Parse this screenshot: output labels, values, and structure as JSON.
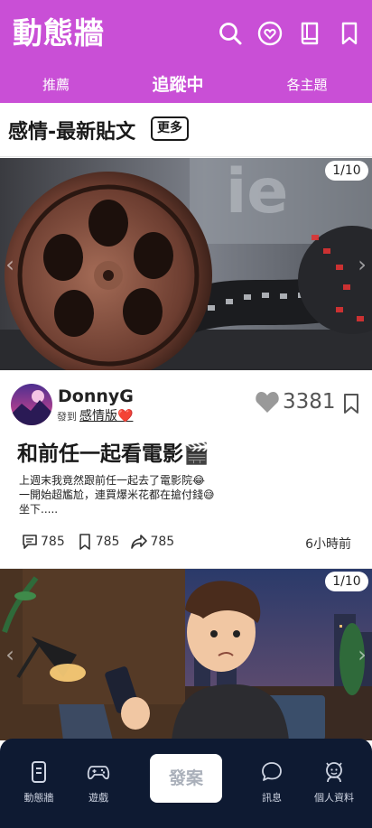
{
  "header": {
    "title": "動態牆",
    "icons": [
      "search-icon",
      "heart-circle-icon",
      "book-icon",
      "bookmark-icon"
    ],
    "brand_color": "#c94fd6"
  },
  "tabs": [
    {
      "label": "推薦",
      "active": false
    },
    {
      "label": "追蹤中",
      "active": true
    },
    {
      "label": "各主題",
      "active": false
    }
  ],
  "section": {
    "title": "感情-最新貼文",
    "more_label": "更多"
  },
  "posts": [
    {
      "image_counter": "1/10",
      "author": "DonnyG",
      "posted_to_label": "發到",
      "board": "感情版❤️",
      "likes": "3381",
      "title": "和前任一起看電影🎬",
      "body_lines": [
        "上週末我竟然跟前任一起去了電影院😂",
        "一開始超尷尬，連買爆米花都在搶付錢😅",
        "坐下....."
      ],
      "comments": "785",
      "bookmarks": "785",
      "shares": "785",
      "time": "6小時前"
    },
    {
      "image_counter": "1/10"
    }
  ],
  "bottom_nav": {
    "items": [
      {
        "label": "動態牆",
        "icon": "phone-icon"
      },
      {
        "label": "遊戲",
        "icon": "gamepad-icon"
      },
      {
        "label": "訊息",
        "icon": "chat-icon"
      },
      {
        "label": "個人資料",
        "icon": "profile-icon"
      }
    ],
    "post_button": "發案",
    "background": "#0e1a32"
  }
}
